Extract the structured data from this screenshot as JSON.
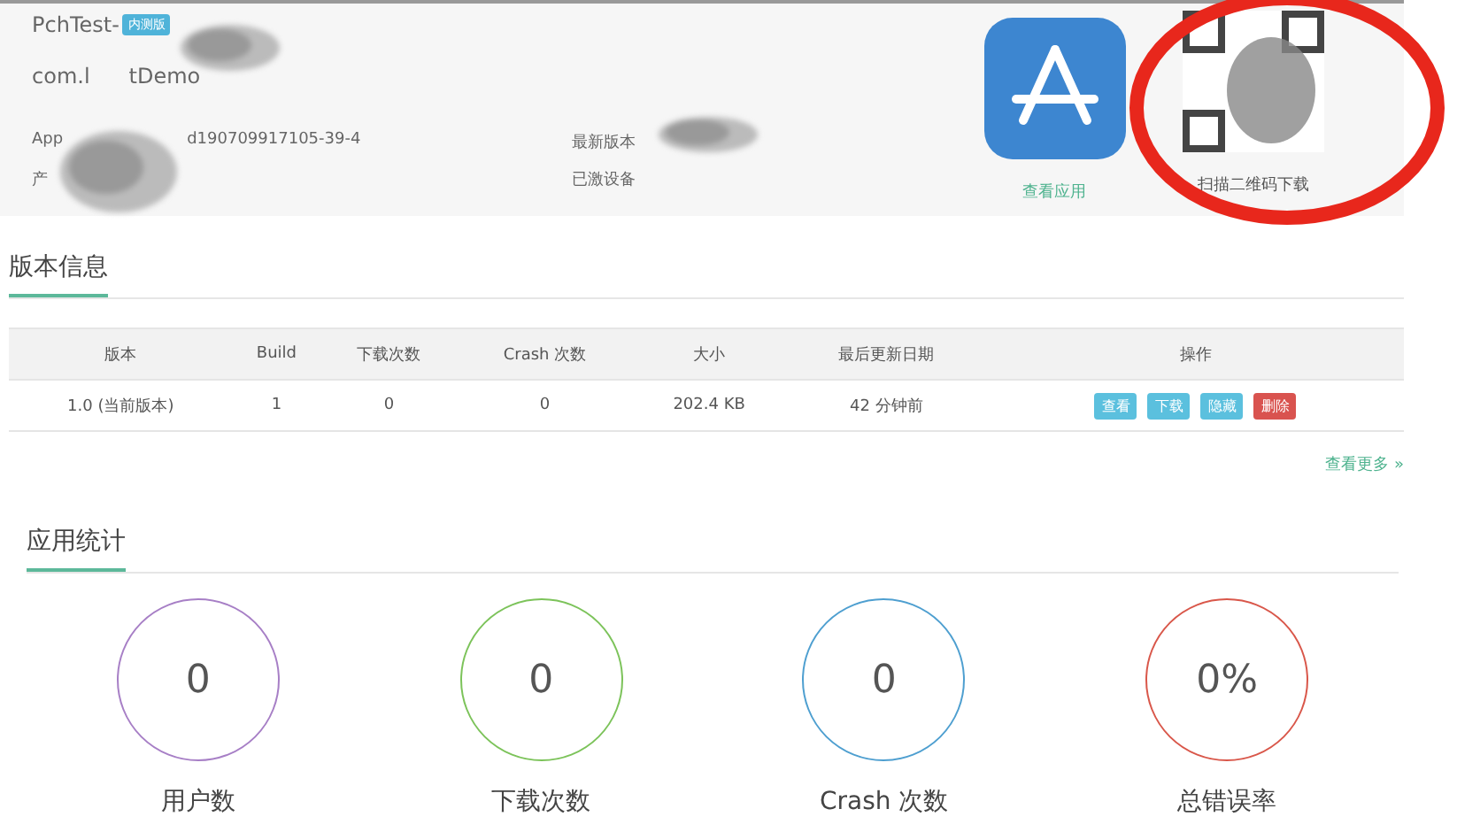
{
  "app": {
    "name": "PchTest-",
    "badge": "内测版",
    "bundle_start": "com.l",
    "bundle_end": "tDemo",
    "id_label": "App",
    "id_value": "d190709917105-39-4",
    "info_label": "产",
    "latest_label": "最新版本",
    "devices_label": "已激设备",
    "view_app": "查看应用",
    "qr_caption": "扫描二维码下载"
  },
  "versions": {
    "title": "版本信息",
    "columns": [
      "版本",
      "Build",
      "下载次数",
      "Crash 次数",
      "大小",
      "最后更新日期",
      "操作"
    ],
    "rows": [
      {
        "cells": [
          "1.0 (当前版本)",
          "1",
          "0",
          "0",
          "202.4 KB",
          "42 分钟前"
        ],
        "actions": [
          {
            "label": "查看",
            "kind": "info"
          },
          {
            "label": "下载",
            "kind": "info"
          },
          {
            "label": "隐藏",
            "kind": "info"
          },
          {
            "label": "删除",
            "kind": "danger"
          }
        ]
      }
    ],
    "more": "查看更多 »"
  },
  "stats": {
    "title": "应用统计",
    "items": [
      {
        "value": "0",
        "label": "用户数",
        "color": "#a77fc6"
      },
      {
        "value": "0",
        "label": "下载次数",
        "color": "#7cc35a"
      },
      {
        "value": "0",
        "label": "Crash 次数",
        "color": "#4e9fd0"
      },
      {
        "value": "0%",
        "label": "总错误率",
        "color": "#d9574a"
      }
    ]
  }
}
